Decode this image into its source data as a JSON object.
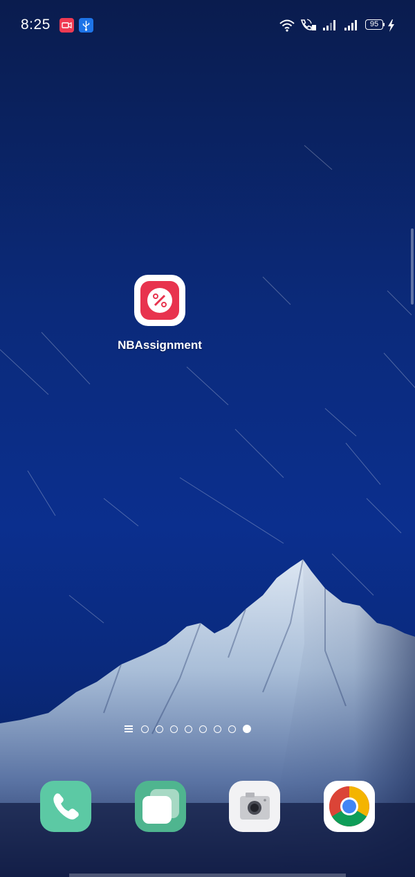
{
  "status_bar": {
    "time": "8:25",
    "notifications": [
      {
        "icon": "screen-record-icon",
        "color": "#ef3a52"
      },
      {
        "icon": "usb-icon",
        "color": "#1e74e8"
      }
    ],
    "system_icons": [
      "wifi-icon",
      "volte-call-icon",
      "signal-1-icon",
      "signal-2-icon"
    ],
    "battery_level": "95",
    "charging": true
  },
  "home": {
    "apps": [
      {
        "label": "NBAssignment",
        "icon": "nb-assignment-icon",
        "color": "#e8334e"
      }
    ],
    "page_indicator": {
      "pages": 8,
      "active_page": 8
    }
  },
  "dock": [
    {
      "icon": "phone-icon",
      "color": "#5cc9a4"
    },
    {
      "icon": "multitask-icon",
      "color": "#4fb58f"
    },
    {
      "icon": "camera-icon",
      "color": "#f2f2f4"
    },
    {
      "icon": "chrome-icon",
      "color": "#ffffff"
    }
  ]
}
